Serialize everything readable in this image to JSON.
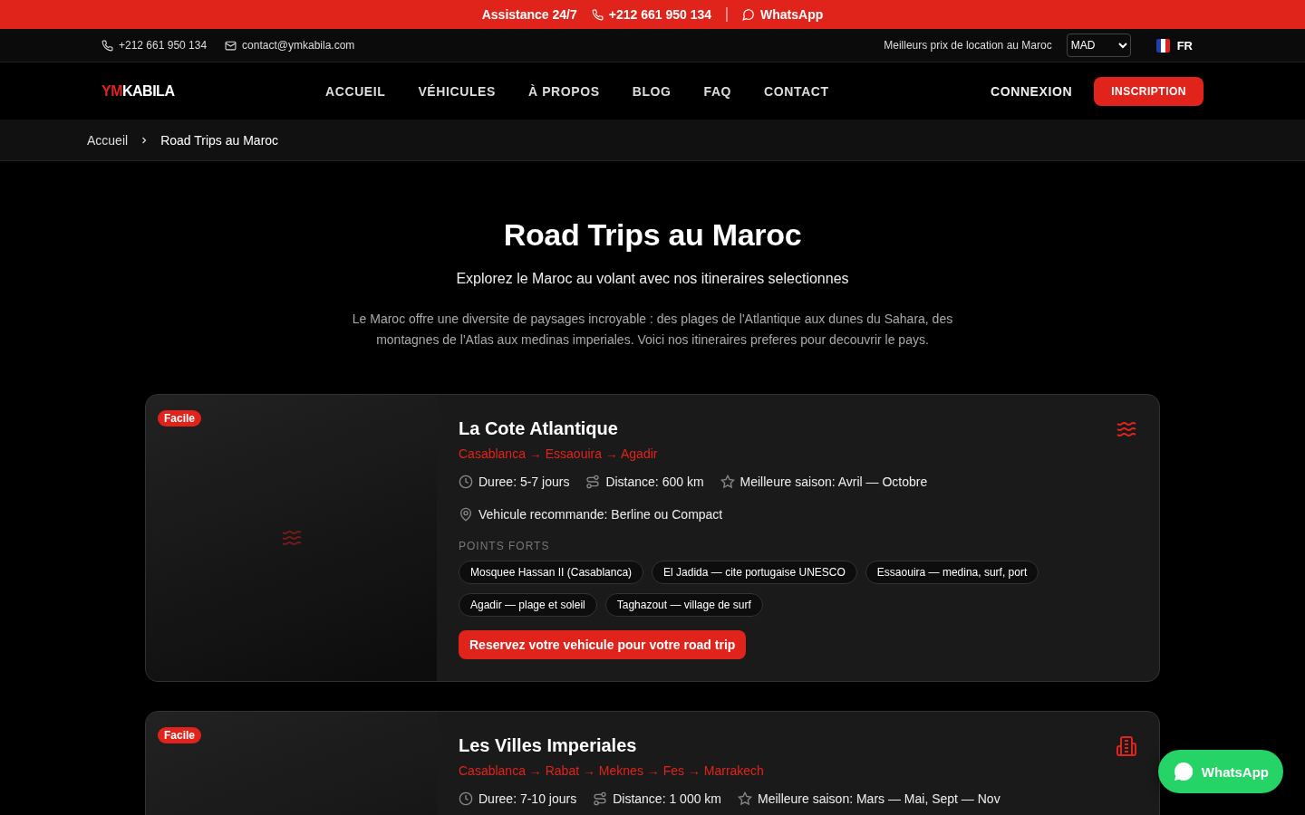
{
  "announcement": {
    "label": "Assistance 24/7",
    "phone": "+212 661 950 134",
    "whatsapp": "WhatsApp"
  },
  "topbar": {
    "phone": "+212 661 950 134",
    "email": "contact@ymkabila.com",
    "tagline": "Meilleurs prix de location au Maroc",
    "currency": "MAD",
    "language": "FR"
  },
  "nav": {
    "logo_accent": "YM",
    "logo_rest": "KABILA",
    "items": [
      {
        "label": "ACCUEIL",
        "selected": false
      },
      {
        "label": "VÉHICULES",
        "selected": false
      },
      {
        "label": "À PROPOS",
        "selected": false
      },
      {
        "label": "BLOG",
        "selected": false
      },
      {
        "label": "FAQ",
        "selected": false
      },
      {
        "label": "CONTACT",
        "selected": false
      }
    ],
    "login": "CONNEXION",
    "signup": "INSCRIPTION"
  },
  "breadcrumb": [
    "Accueil",
    "Road Trips au Maroc"
  ],
  "hero": {
    "title": "Road Trips au Maroc",
    "subtitle": "Explorez le Maroc au volant avec nos itineraires selectionnes",
    "intro": "Le Maroc offre une diversite de paysages incroyable : des plages de l'Atlantique aux dunes du Sahara, des montagnes de l'Atlas aux medinas imperiales. Voici nos itineraires preferes pour decouvrir le pays."
  },
  "trips": [
    {
      "kind": "waves",
      "difficulty": "Facile",
      "title": "La Cote Atlantique",
      "route": "Casablanca → Essaouira → Agadir",
      "duration": "Duree: 5-7 jours",
      "distance": "Distance: 600 km",
      "season": "Meilleure saison: Avril — Octobre",
      "vehicle": "Vehicule recommande: Berline ou Compact",
      "highlights_label": "POINTS FORTS",
      "highlights": [
        "Mosquee Hassan II (Casablanca)",
        "El Jadida — cite portugaise UNESCO",
        "Essaouira — medina, surf, port",
        "Agadir — plage et soleil",
        "Taghazout — village de surf"
      ],
      "cta": "Reservez votre vehicule pour votre road trip"
    },
    {
      "kind": "building",
      "difficulty": "Facile",
      "title": "Les Villes Imperiales",
      "route": "Casablanca → Rabat → Meknes → Fes → Marrakech",
      "duration": "Duree: 7-10 jours",
      "distance": "Distance: 1 000 km",
      "season": "Meilleure saison: Mars — Mai, Sept — Nov"
    }
  ],
  "whatsapp_button": "WhatsApp"
}
